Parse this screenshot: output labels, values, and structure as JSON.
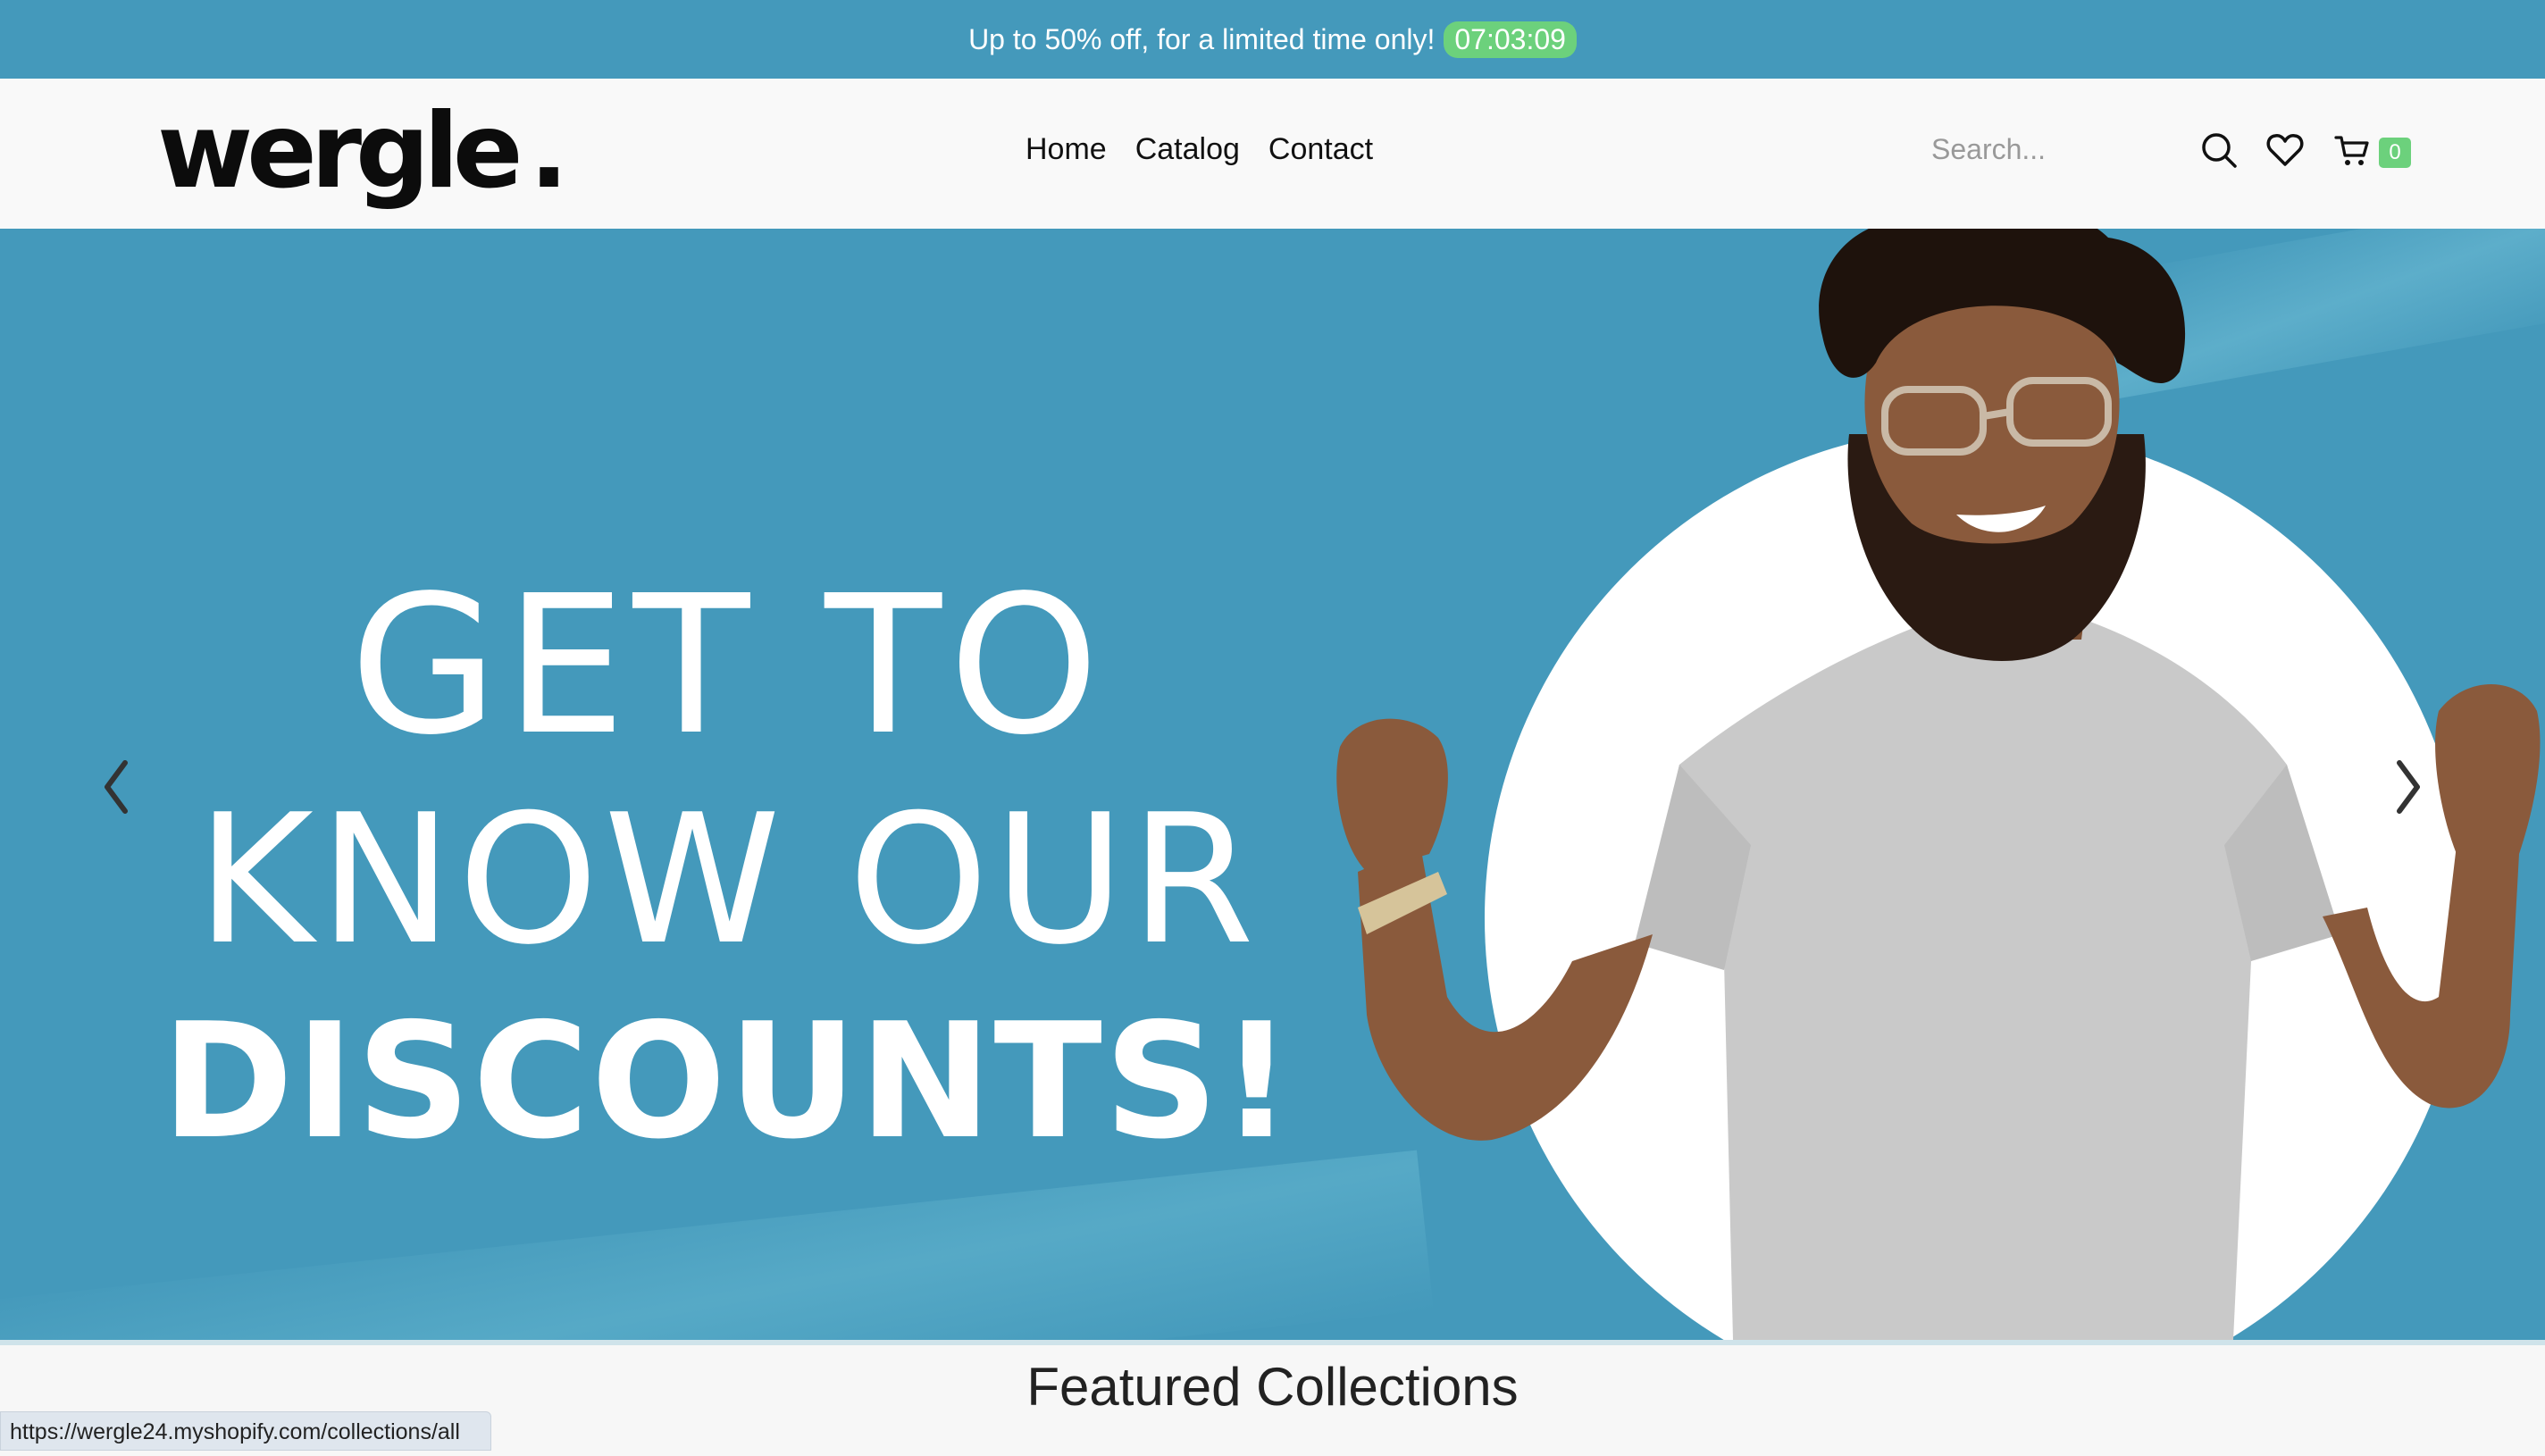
{
  "announcement": {
    "text": "Up to 50% off, for a limited time only!",
    "timer": "07:03:09"
  },
  "header": {
    "logo": "wergle",
    "logo_dot": ".",
    "nav": [
      "Home",
      "Catalog",
      "Contact"
    ],
    "search_placeholder": "Search...",
    "cart_count": "0",
    "icons": [
      "search-icon",
      "heart-icon",
      "cart-icon"
    ]
  },
  "hero": {
    "line1": "GET TO",
    "line2": "KNOW OUR",
    "line3": "DISCOUNTS!",
    "background_color": "#4499bb",
    "prev_icon": "chevron-left-icon",
    "next_icon": "chevron-right-icon"
  },
  "featured": {
    "title": "Featured Collections"
  },
  "status_bar": {
    "url": "https://wergle24.myshopify.com/collections/all"
  },
  "colors": {
    "accent_green": "#6cd17c",
    "brand_blue": "#4499bb"
  }
}
